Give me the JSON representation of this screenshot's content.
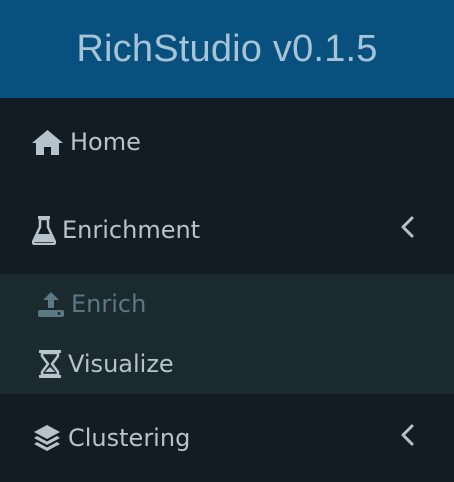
{
  "header": {
    "brand": "RichStudio v0.1.5"
  },
  "sidebar": {
    "items": [
      {
        "label": "Home",
        "icon": "home-icon"
      },
      {
        "label": "Enrichment",
        "icon": "flask-icon",
        "expanded": true,
        "children": [
          {
            "label": "Enrich",
            "icon": "upload-icon"
          },
          {
            "label": "Visualize",
            "icon": "hourglass-icon"
          }
        ]
      },
      {
        "label": "Clustering",
        "icon": "layers-icon",
        "expanded": false
      }
    ]
  },
  "colors": {
    "header_bg": "#08507e",
    "sidebar_bg": "#141c23",
    "submenu_bg": "#1a2a2f",
    "text": "#b6c3cc",
    "muted_text": "#5c7983"
  }
}
